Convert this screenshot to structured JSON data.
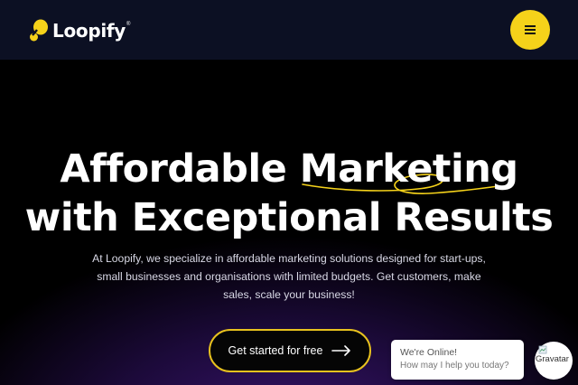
{
  "header": {
    "brand": "Loopify",
    "trademark": "®",
    "menu_icon": "hamburger-icon",
    "accent_color": "#f5d21a",
    "background_color": "#0c1023"
  },
  "hero": {
    "headline_line1": "Affordable Marketing",
    "headline_line2": "with Exceptional Results",
    "subtext": "At Loopify, we specialize in affordable marketing solutions designed for start-ups, small businesses and organisations with limited budgets. Get customers, make sales, scale your business!",
    "cta_label": "Get started for free",
    "cta_icon": "arrow-right-icon",
    "cta_border_color": "#e8c21e"
  },
  "chat_widget": {
    "title": "We're Online!",
    "message": "How may I help you today?",
    "avatar_label": "Gravatar"
  }
}
